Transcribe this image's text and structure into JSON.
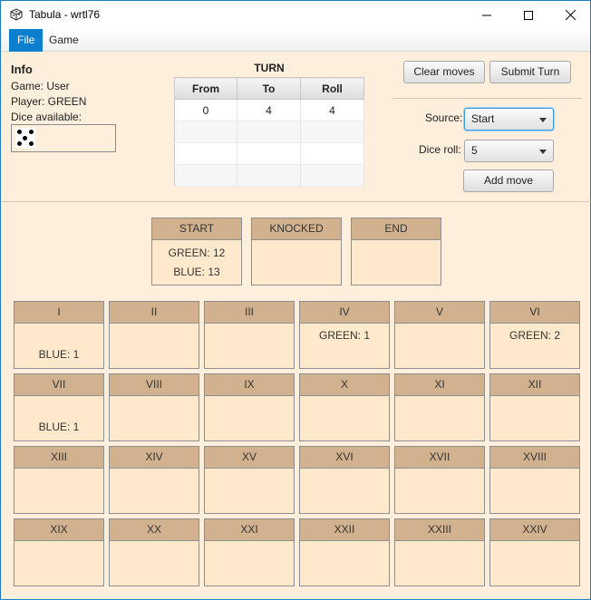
{
  "window": {
    "title": "Tabula - wrtl76"
  },
  "menu": {
    "file": "File",
    "game": "Game"
  },
  "info": {
    "title": "Info",
    "game": "Game: User",
    "player": "Player: GREEN",
    "dice_label": "Dice available:",
    "dice": [
      5
    ]
  },
  "turn": {
    "title": "TURN",
    "headers": [
      "From",
      "To",
      "Roll"
    ],
    "rows": [
      [
        "0",
        "4",
        "4"
      ],
      [
        "",
        "",
        ""
      ],
      [
        "",
        "",
        ""
      ],
      [
        "",
        "",
        ""
      ]
    ]
  },
  "controls": {
    "clear_moves": "Clear moves",
    "submit_turn": "Submit Turn",
    "source_label": "Source:",
    "source_value": "Start",
    "dice_roll_label": "Dice roll:",
    "dice_roll_value": "5",
    "add_move": "Add move"
  },
  "specials": [
    {
      "name": "START",
      "lines": [
        "GREEN: 12",
        "BLUE: 13"
      ]
    },
    {
      "name": "KNOCKED",
      "lines": []
    },
    {
      "name": "END",
      "lines": []
    }
  ],
  "points": [
    {
      "name": "I",
      "lines": [
        "BLUE: 1"
      ],
      "pos": "bottom"
    },
    {
      "name": "II",
      "lines": []
    },
    {
      "name": "III",
      "lines": []
    },
    {
      "name": "IV",
      "lines": [
        "GREEN: 1"
      ],
      "pos": "top"
    },
    {
      "name": "V",
      "lines": []
    },
    {
      "name": "VI",
      "lines": [
        "GREEN: 2"
      ],
      "pos": "top"
    },
    {
      "name": "VII",
      "lines": [
        "BLUE: 1"
      ],
      "pos": "bottom"
    },
    {
      "name": "VIII",
      "lines": []
    },
    {
      "name": "IX",
      "lines": []
    },
    {
      "name": "X",
      "lines": []
    },
    {
      "name": "XI",
      "lines": []
    },
    {
      "name": "XII",
      "lines": []
    },
    {
      "name": "XIII",
      "lines": []
    },
    {
      "name": "XIV",
      "lines": []
    },
    {
      "name": "XV",
      "lines": []
    },
    {
      "name": "XVI",
      "lines": []
    },
    {
      "name": "XVII",
      "lines": []
    },
    {
      "name": "XVIII",
      "lines": []
    },
    {
      "name": "XIX",
      "lines": []
    },
    {
      "name": "XX",
      "lines": []
    },
    {
      "name": "XXI",
      "lines": []
    },
    {
      "name": "XXII",
      "lines": []
    },
    {
      "name": "XXIII",
      "lines": []
    },
    {
      "name": "XXIV",
      "lines": []
    }
  ]
}
